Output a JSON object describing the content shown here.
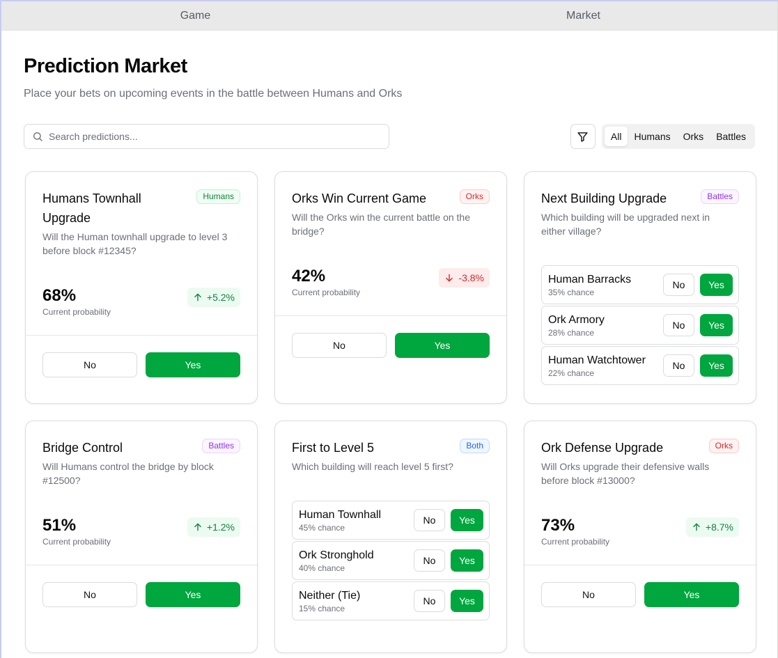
{
  "tabs": [
    "Game",
    "Market"
  ],
  "header": {
    "title": "Prediction Market",
    "subtitle": "Place your bets on upcoming events in the battle between Humans and Orks"
  },
  "search": {
    "placeholder": "Search predictions..."
  },
  "filters": [
    "All",
    "Humans",
    "Orks",
    "Battles"
  ],
  "active_filter": "All",
  "labels": {
    "no": "No",
    "yes": "Yes",
    "current_probability": "Current probability"
  },
  "colors": {
    "yes_green": "#00a63e",
    "up_green": "#15803d",
    "down_red": "#dc2626",
    "badge_humans": "#15803d",
    "badge_orks": "#dc2626",
    "badge_battles": "#9333ea",
    "badge_both": "#2563eb"
  },
  "cards": [
    {
      "title": "Humans Townhall Upgrade",
      "badge": "Humans",
      "description": "Will the Human townhall upgrade to level 3 before block #12345?",
      "probability": "68%",
      "change": "+5.2%",
      "direction": "up"
    },
    {
      "title": "Orks Win Current Game",
      "badge": "Orks",
      "description": "Will the Orks win the current battle on the bridge?",
      "probability": "42%",
      "change": "-3.8%",
      "direction": "down"
    },
    {
      "title": "Next Building Upgrade",
      "badge": "Battles",
      "description": "Which building will be upgraded next in either village?",
      "options": [
        {
          "name": "Human Barracks",
          "chance": "35% chance"
        },
        {
          "name": "Ork Armory",
          "chance": "28% chance"
        },
        {
          "name": "Human Watchtower",
          "chance": "22% chance"
        }
      ]
    },
    {
      "title": "Bridge Control",
      "badge": "Battles",
      "description": "Will Humans control the bridge by block #12500?",
      "probability": "51%",
      "change": "+1.2%",
      "direction": "up"
    },
    {
      "title": "First to Level 5",
      "badge": "Both",
      "description": "Which building will reach level 5 first?",
      "options": [
        {
          "name": "Human Townhall",
          "chance": "45% chance"
        },
        {
          "name": "Ork Stronghold",
          "chance": "40% chance"
        },
        {
          "name": "Neither (Tie)",
          "chance": "15% chance"
        }
      ]
    },
    {
      "title": "Ork Defense Upgrade",
      "badge": "Orks",
      "description": "Will Orks upgrade their defensive walls before block #13000?",
      "probability": "73%",
      "change": "+8.7%",
      "direction": "up"
    }
  ]
}
